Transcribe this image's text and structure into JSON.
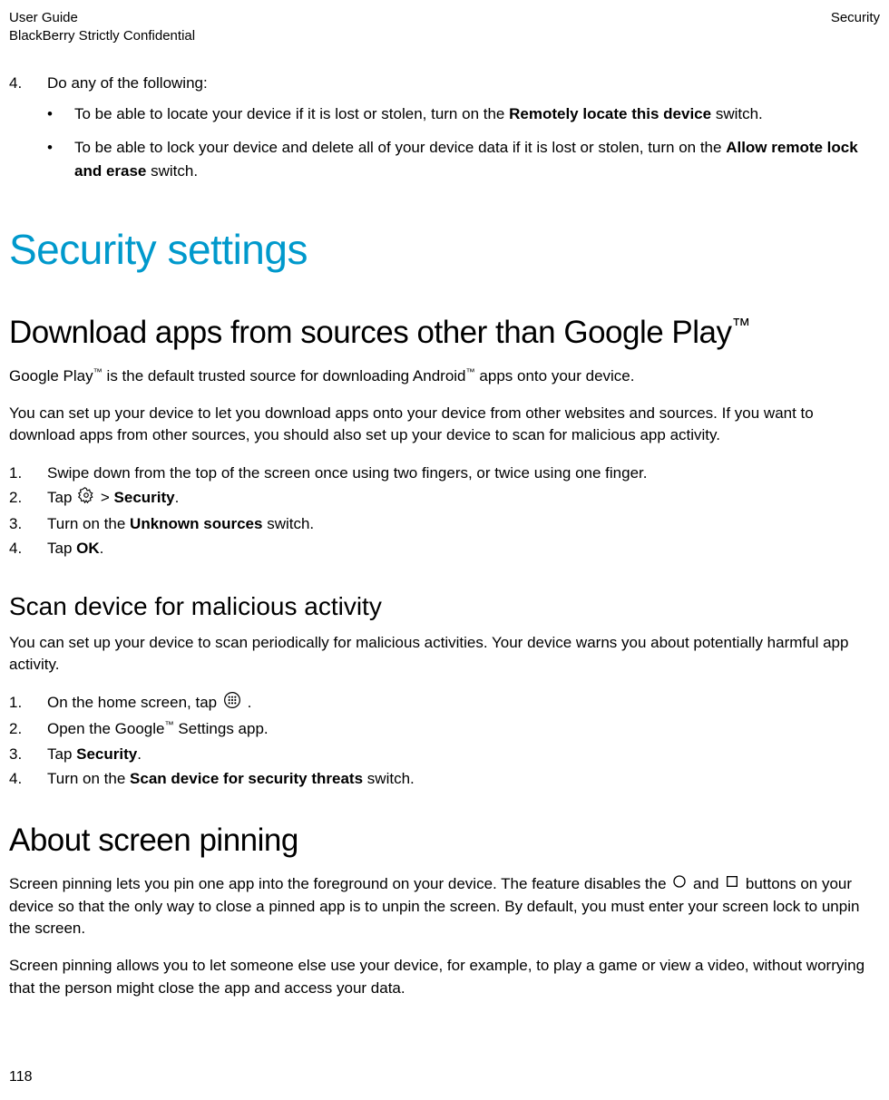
{
  "header": {
    "guide": "User Guide",
    "confidential": "BlackBerry Strictly Confidential",
    "section": "Security"
  },
  "topList": {
    "num": "4.",
    "intro": "Do any of the following:",
    "bullets": [
      {
        "pre": "To be able to locate your device if it is lost or stolen, turn on the ",
        "bold": "Remotely locate this device",
        "post": " switch."
      },
      {
        "pre": "To be able to lock your device and delete all of your device data if it is lost or stolen, turn on the ",
        "bold": "Allow remote lock and erase",
        "post": " switch."
      }
    ]
  },
  "h1": "Security settings",
  "downloadSection": {
    "titlePre": "Download apps from sources other than Google Play",
    "tm": "™",
    "para1a": "Google Play",
    "para1b": " is the default trusted source for downloading Android",
    "para1c": " apps onto your device.",
    "para2": "You can set up your device to let you download apps onto your device from other websites and sources. If you want to download apps from other sources, you should also set up your device to scan for malicious app activity.",
    "steps": [
      {
        "num": "1.",
        "text": "Swipe down from the top of the screen once using two fingers, or twice using one finger."
      },
      {
        "num": "2.",
        "pre": "Tap ",
        "icon": "settings",
        "mid": " > ",
        "bold": "Security",
        "post": "."
      },
      {
        "num": "3.",
        "pre": "Turn on the ",
        "bold": "Unknown sources",
        "post": " switch."
      },
      {
        "num": "4.",
        "pre": "Tap ",
        "bold": "OK",
        "post": "."
      }
    ]
  },
  "scanSection": {
    "title": "Scan device for malicious activity",
    "para": "You can set up your device to scan periodically for malicious activities. Your device warns you about potentially harmful app activity.",
    "steps": [
      {
        "num": "1.",
        "pre": "On the home screen, tap ",
        "icon": "apps",
        "post": " ."
      },
      {
        "num": "2.",
        "pre": "Open the Google",
        "sup": "™",
        "post": " Settings app."
      },
      {
        "num": "3.",
        "pre": "Tap ",
        "bold": "Security",
        "post": "."
      },
      {
        "num": "4.",
        "pre": "Turn on the ",
        "bold": "Scan device for security threats",
        "post": " switch."
      }
    ]
  },
  "pinningSection": {
    "title": "About screen pinning",
    "para1a": "Screen pinning lets you pin one app into the foreground on your device. The feature disables the ",
    "para1b": " and ",
    "para1c": " buttons on your device so that the only way to close a pinned app is to unpin the screen. By default, you must enter your screen lock to unpin the screen.",
    "para2": "Screen pinning allows you to let someone else use your device, for example, to play a game or view a video, without worrying that the person might close the app and access your data."
  },
  "pageNumber": "118"
}
